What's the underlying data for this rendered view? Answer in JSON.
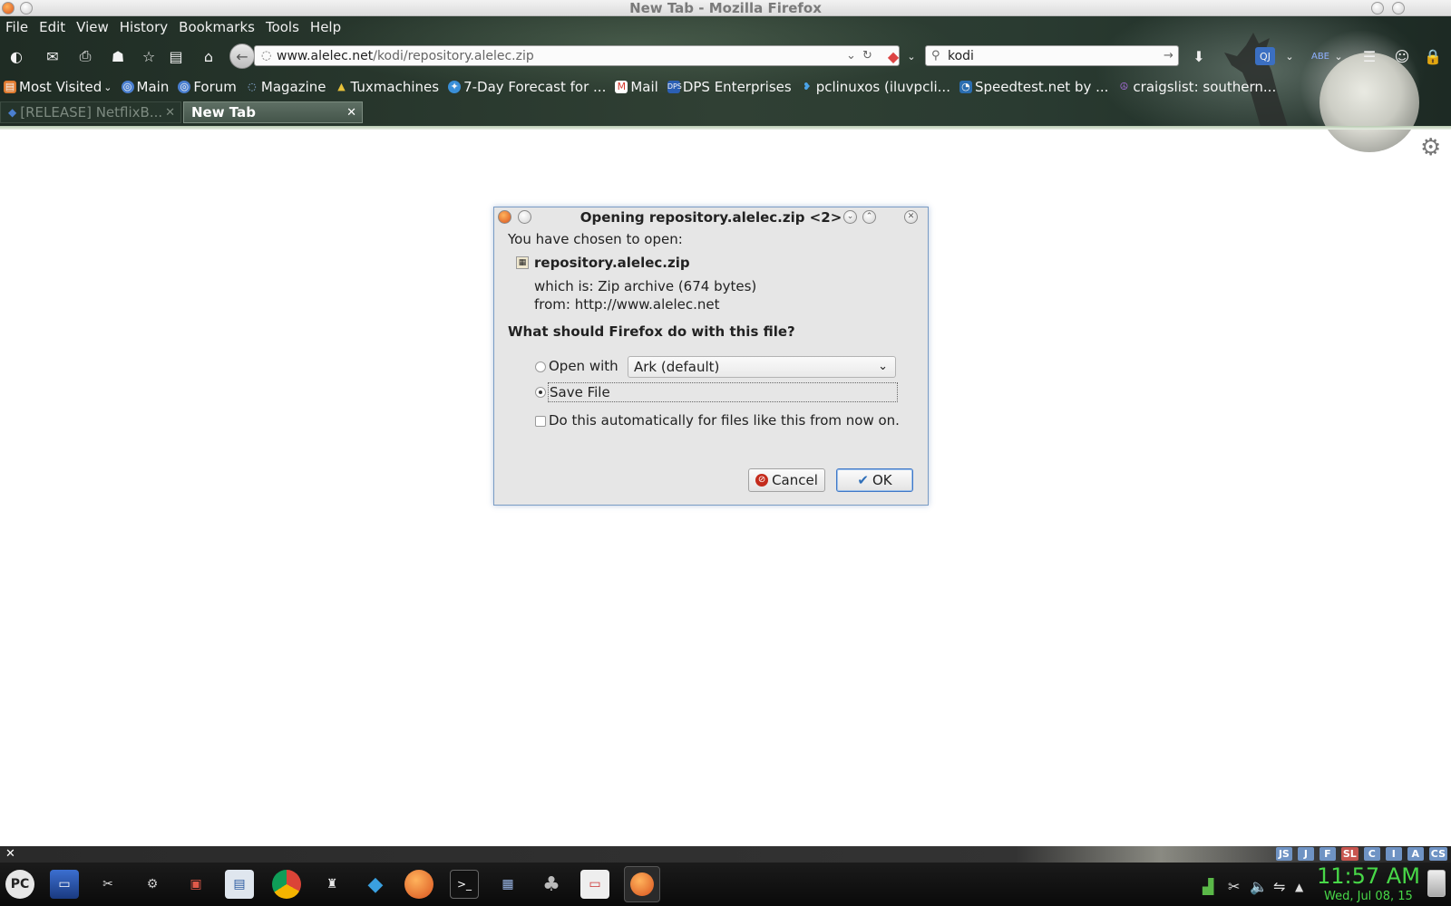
{
  "window": {
    "title": "New Tab - Mozilla Firefox"
  },
  "menubar": [
    "File",
    "Edit",
    "View",
    "History",
    "Bookmarks",
    "Tools",
    "Help"
  ],
  "navbar": {
    "url_host": "www.alelec.net",
    "url_path": "/kodi/repository.alelec.zip",
    "search_value": "kodi"
  },
  "bookmarks": [
    {
      "label": "Most Visited",
      "icon": "folder-icon",
      "color": "#e07b2f"
    },
    {
      "label": "Main",
      "icon": "pclinuxos-icon",
      "color": "#4a7fd0"
    },
    {
      "label": "Forum",
      "icon": "pclinuxos-icon",
      "color": "#4a7fd0"
    },
    {
      "label": "Magazine",
      "icon": "magazine-icon",
      "color": "#4a7fd0"
    },
    {
      "label": "Tuxmachines",
      "icon": "tux-icon",
      "color": "#e8c23a"
    },
    {
      "label": "7-Day Forecast for ...",
      "icon": "weather-icon",
      "color": "#3a8fd8"
    },
    {
      "label": "Mail",
      "icon": "gmail-icon",
      "color": "#d63b30"
    },
    {
      "label": "DPS Enterprises",
      "icon": "dps-icon",
      "color": "#2b5fb4"
    },
    {
      "label": "pclinuxos (iluvpcli...",
      "icon": "twitter-icon",
      "color": "#4aa3e8"
    },
    {
      "label": "Speedtest.net by ...",
      "icon": "speedtest-icon",
      "color": "#2a6db0"
    },
    {
      "label": "craigslist: southern...",
      "icon": "peace-icon",
      "color": "#7a3aa8"
    }
  ],
  "tabs": [
    {
      "label": "[RELEASE] NetflixB...",
      "active": false
    },
    {
      "label": "New Tab",
      "active": true
    }
  ],
  "dialog": {
    "title": "Opening repository.alelec.zip <2>",
    "chosen_label": "You have chosen to open:",
    "filename": "repository.alelec.zip",
    "which_is": "which is: Zip archive (674 bytes)",
    "from": "from: http://www.alelec.net",
    "question": "What should Firefox do with this file?",
    "open_with_label": "Open with",
    "open_with_app": "Ark (default)",
    "save_file_label": "Save File",
    "auto_label": "Do this automatically for files like this from now on.",
    "selected_option": "save",
    "cancel_label": "Cancel",
    "ok_label": "OK"
  },
  "panel_tags": [
    "JS",
    "J",
    "F",
    "SL",
    "C",
    "I",
    "A",
    "CS"
  ],
  "taskbar": {
    "start_label": "PC",
    "clock": "11:57 AM",
    "date": "Wed, Jul 08, 15"
  }
}
